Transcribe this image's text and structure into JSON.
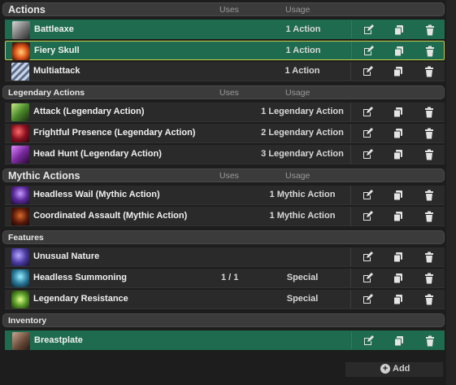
{
  "colors": {
    "highlight": "#1e6b4f",
    "selected_border": "#c7cf47",
    "header_bg": "#3b3b3b",
    "row_bg": "#2a2a2a"
  },
  "sections": {
    "actions": {
      "title": "Actions",
      "col_uses": "Uses",
      "col_usage": "Usage",
      "items": [
        {
          "name": "Battleaxe",
          "uses": "",
          "usage": "1 Action",
          "icon": "battleaxe-icon"
        },
        {
          "name": "Fiery Skull",
          "uses": "",
          "usage": "1 Action",
          "icon": "fiery-skull-icon"
        },
        {
          "name": "Multiattack",
          "uses": "",
          "usage": "1 Action",
          "icon": "multiattack-icon"
        }
      ]
    },
    "legendary": {
      "title": "Legendary Actions",
      "col_uses": "Uses",
      "col_usage": "Usage",
      "items": [
        {
          "name": "Attack (Legendary Action)",
          "uses": "",
          "usage": "1 Legendary Action",
          "icon": "legendary-attack-icon"
        },
        {
          "name": "Frightful Presence (Legendary Action)",
          "uses": "",
          "usage": "2 Legendary Action",
          "icon": "frightful-presence-icon"
        },
        {
          "name": "Head Hunt (Legendary Action)",
          "uses": "",
          "usage": "3 Legendary Action",
          "icon": "head-hunt-icon"
        }
      ]
    },
    "mythic": {
      "title": "Mythic Actions",
      "col_uses": "Uses",
      "col_usage": "Usage",
      "items": [
        {
          "name": "Headless Wail (Mythic Action)",
          "uses": "",
          "usage": "1 Mythic Action",
          "icon": "headless-wail-icon"
        },
        {
          "name": "Coordinated Assault (Mythic Action)",
          "uses": "",
          "usage": "1 Mythic Action",
          "icon": "coordinated-assault-icon"
        }
      ]
    },
    "features": {
      "title": "Features",
      "items": [
        {
          "name": "Unusual Nature",
          "uses": "",
          "usage": "",
          "icon": "unusual-nature-icon"
        },
        {
          "name": "Headless Summoning",
          "uses": "1 / 1",
          "usage": "Special",
          "icon": "headless-summoning-icon"
        },
        {
          "name": "Legendary Resistance",
          "uses": "",
          "usage": "Special",
          "icon": "legendary-resistance-icon"
        }
      ]
    },
    "inventory": {
      "title": "Inventory",
      "items": [
        {
          "name": "Breastplate",
          "uses": "",
          "usage": "",
          "icon": "breastplate-icon"
        }
      ],
      "add_label": "Add"
    }
  }
}
